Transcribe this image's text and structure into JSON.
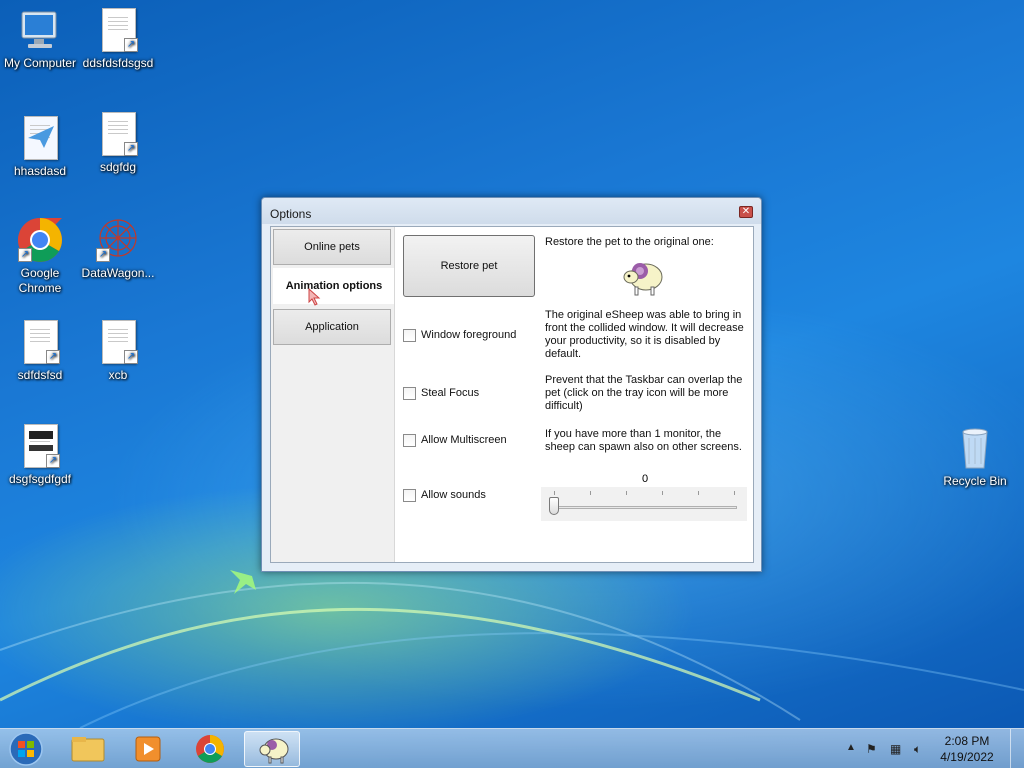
{
  "desktop": {
    "icons": [
      {
        "label": "My Computer"
      },
      {
        "label": "ddsfdsfdsgsd"
      },
      {
        "label": "hhasdasd"
      },
      {
        "label": "sdgfdg"
      },
      {
        "label": "Google\nChrome"
      },
      {
        "label": "DataWagon..."
      },
      {
        "label": "sdfdsfsd"
      },
      {
        "label": "xcb"
      },
      {
        "label": "dsgfsgdfgdf"
      },
      {
        "label": "Recycle Bin"
      }
    ]
  },
  "window": {
    "title": "Options",
    "tabs": [
      {
        "label": "Online pets"
      },
      {
        "label": "Animation options"
      },
      {
        "label": "Application"
      }
    ],
    "panel": {
      "restore_button": "Restore pet",
      "restore_desc": "Restore the pet to the original one:",
      "options": [
        {
          "label": "Window foreground",
          "checked": false,
          "desc": "The original eSheep was able to bring in front the collided window. It will decrease your productivity, so it is disabled by default."
        },
        {
          "label": "Steal Focus",
          "checked": false,
          "desc": "Prevent that the Taskbar can overlap the pet (click on the tray icon will be more difficult)"
        },
        {
          "label": "Allow Multiscreen",
          "checked": false,
          "desc": "If you have more than 1 monitor, the sheep can spawn also on other screens."
        },
        {
          "label": "Allow sounds",
          "checked": false,
          "desc": ""
        }
      ],
      "slider_value": "0"
    }
  },
  "taskbar": {
    "pinned": [
      "start-button",
      "explorer",
      "media-player",
      "chrome",
      "esheep"
    ],
    "clock": {
      "time": "2:08 PM",
      "date": "4/19/2022"
    }
  }
}
